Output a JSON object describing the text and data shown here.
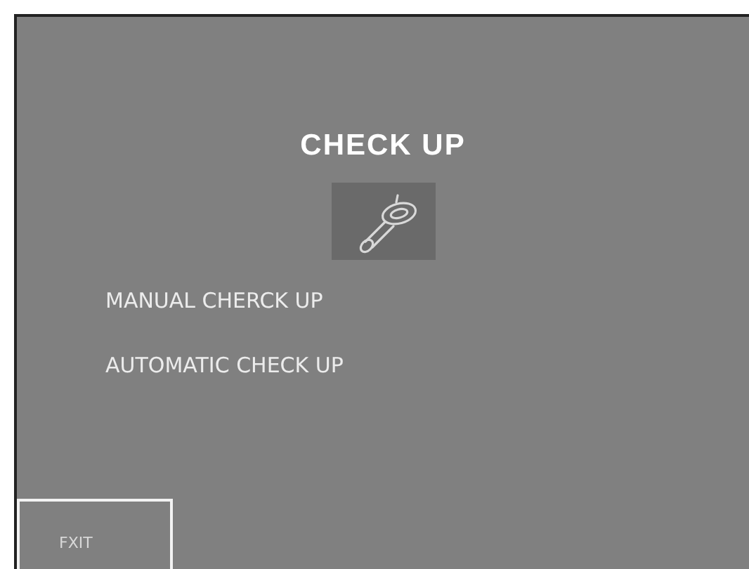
{
  "title": "CHECK UP",
  "menu": [
    {
      "label": "MANUAL CHERCK UP"
    },
    {
      "label": "AUTOMATIC CHECK UP"
    }
  ],
  "exit_button": {
    "label": "FXIT"
  }
}
